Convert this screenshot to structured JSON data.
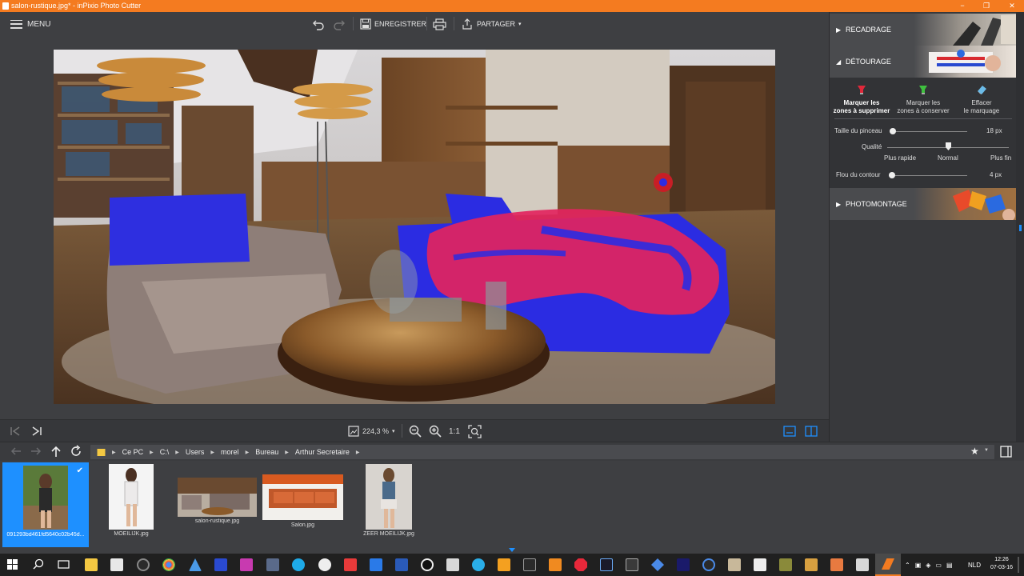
{
  "window": {
    "title": "salon-rustique.jpg* - inPixio Photo Cutter",
    "minimize": "−",
    "maximize": "❐",
    "close": "✕"
  },
  "toolbar": {
    "menu_label": "MENU",
    "save_label": "ENREGISTRER",
    "share_label": "PARTAGER",
    "share_caret": "▾"
  },
  "status": {
    "zoom_value": "224,3 %",
    "zoom_caret": "▾",
    "one_to_one": "1:1"
  },
  "panel": {
    "recadrage": {
      "label": "RECADRAGE",
      "arrow": "▶"
    },
    "detourage": {
      "label": "DÉTOURAGE",
      "arrow": "◢",
      "tools": [
        {
          "label_line1": "Marquer les",
          "label_line2": "zones à supprimer",
          "color": "#e0283a",
          "icon": "red-marker-icon"
        },
        {
          "label_line1": "Marquer les",
          "label_line2": "zones à conserver",
          "color": "#3fc03f",
          "icon": "green-marker-icon"
        },
        {
          "label_line1": "Effacer",
          "label_line2": "le marquage",
          "color": "#6bbbe8",
          "icon": "eraser-icon"
        }
      ],
      "brush_size_label": "Taille du pinceau",
      "brush_size_value": "18 px",
      "brush_size_level": 0.03,
      "quality_label": "Qualité",
      "quality_level": 0.5,
      "quality_fast": "Plus rapide",
      "quality_normal": "Normal",
      "quality_fine": "Plus fin",
      "blur_label": "Flou du contour",
      "blur_value": "4 px",
      "blur_level": 0.0
    },
    "photomontage": {
      "label": "PHOTOMONTAGE",
      "arrow": "▶"
    }
  },
  "breadcrumb": {
    "items": [
      "Ce PC",
      "C:\\",
      "Users",
      "morel",
      "Bureau",
      "Arthur Secretaire"
    ]
  },
  "filmstrip": {
    "items": [
      {
        "label": "091293bd461fd5640c02b45d...",
        "selected": true
      },
      {
        "label": "MOEILIJK.jpg",
        "selected": false
      },
      {
        "label": "salon-rustique.jpg",
        "selected": false
      },
      {
        "label": "Salon.jpg",
        "selected": false
      },
      {
        "label": "ZEER MOEILIJK.jpg",
        "selected": false
      }
    ]
  },
  "taskbar": {
    "language": "NLD",
    "time": "12:26",
    "date": "07-03-16"
  },
  "colors": {
    "accent": "#f47b20",
    "selection": "#1e90ff",
    "keep_mark": "#2d2de6",
    "remove_mark": "#e2245e"
  }
}
